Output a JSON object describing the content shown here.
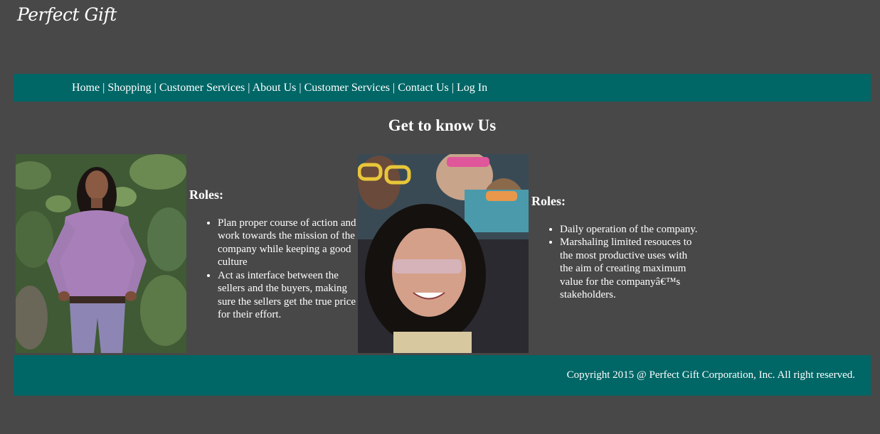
{
  "site": {
    "logo": "Perfect Gift"
  },
  "nav": {
    "items": [
      "Home",
      "Shopping",
      "Customer Services",
      "About Us",
      "Customer Services",
      "Contact Us",
      "Log In"
    ],
    "separator": "|"
  },
  "main": {
    "heading": "Get to know Us",
    "members": [
      {
        "roles_title": "Roles:",
        "roles": [
          "Plan proper course of action and work towards the mission of the company while keeping a good culture",
          "Act as interface between the sellers and the buyers, making sure the sellers get the true price for their effort."
        ]
      },
      {
        "roles_title": "Roles:",
        "roles": [
          "Daily operation of the company.",
          "Marshaling limited resouces to the most productive uses with the aim of creating maximum value for the companyâ€™s stakeholders."
        ]
      }
    ]
  },
  "footer": {
    "copyright": "Copyright 2015 @ Perfect Gift Corporation, Inc. All right reserved."
  },
  "colors": {
    "background": "#484848",
    "accent": "#006666",
    "text": "#ffffff"
  }
}
